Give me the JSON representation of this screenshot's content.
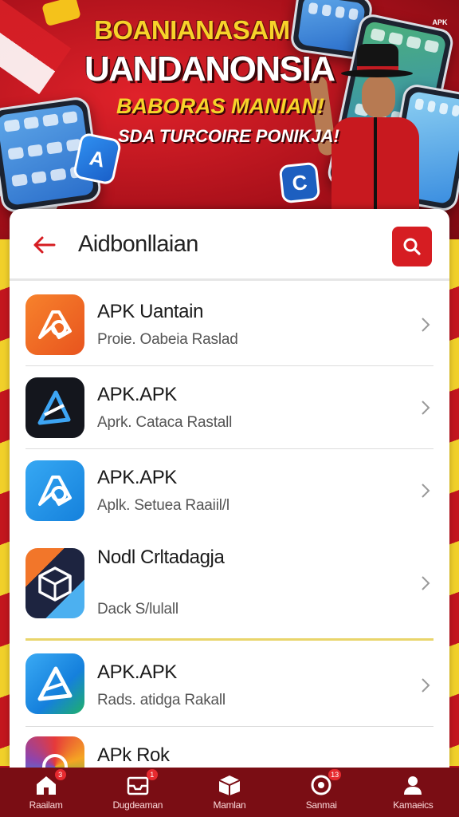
{
  "banner": {
    "line1": "BOANIANASAM",
    "line2": "UANDANONSIA",
    "line3": "BABORAS MANIAN!",
    "line4": "SDA TURCOIRE PONIKJA!",
    "corner_logo": "APK"
  },
  "header": {
    "title": "Aidbonllaian",
    "back_icon": "arrow-left-icon",
    "search_icon": "search-icon",
    "accent": "#d61d22"
  },
  "apps": [
    {
      "name": "APK Uantain",
      "subtitle": "Proie. Oabeia Raslad",
      "icon": "orange-apk-icon",
      "color": "#f06a25"
    },
    {
      "name": "APK.APK",
      "subtitle": "Aprk. Cataca Rastall",
      "icon": "dark-apk-icon",
      "color": "#14161d"
    },
    {
      "name": "APK.APK",
      "subtitle": "Aplk. Setuea Raaiil/l",
      "icon": "blue-apk-icon",
      "color": "#1e8fe6"
    },
    {
      "name": "Nodl Crltadagja",
      "subtitle": "Dack S/lulall",
      "icon": "cube-apk-icon",
      "color": "#1d2440"
    },
    {
      "name": "APK.APK",
      "subtitle": "Rads. atidga Rakall",
      "icon": "blue-a-apk-icon",
      "color": "#1e8fe6"
    },
    {
      "name": "APk Rok",
      "subtitle": "",
      "icon": "rainbow-apk-icon",
      "color": "#6a3bd0"
    }
  ],
  "nav": [
    {
      "label": "Raailam",
      "icon": "home-icon",
      "badge": "3"
    },
    {
      "label": "Dugdeaman",
      "icon": "inbox-icon",
      "badge": "1"
    },
    {
      "label": "Mamlan",
      "icon": "box-icon",
      "badge": ""
    },
    {
      "label": "Sanmai",
      "icon": "target-icon",
      "badge": "13"
    },
    {
      "label": "Kamaeics",
      "icon": "user-icon",
      "badge": ""
    }
  ]
}
